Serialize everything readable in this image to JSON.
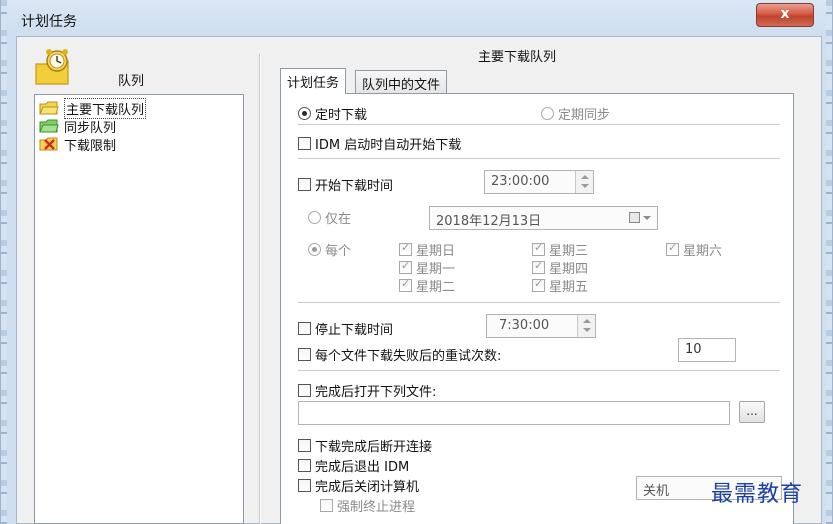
{
  "window": {
    "title": "计划任务",
    "close_label": "x"
  },
  "left": {
    "queue_header": "队列",
    "queues": [
      {
        "label": "主要下载队列",
        "selected": true
      },
      {
        "label": "同步队列",
        "selected": false
      },
      {
        "label": "下载限制",
        "selected": false
      }
    ]
  },
  "right": {
    "pane_title": "主要下载队列",
    "tabs": [
      {
        "label": "计划任务",
        "active": true
      },
      {
        "label": "队列中的文件",
        "active": false
      }
    ],
    "mode": {
      "timed_download": "定时下载",
      "periodic_sync": "定期同步"
    },
    "auto_start_idm": "IDM 启动时自动开始下载",
    "start_time": {
      "label": "开始下载时间",
      "value": "23:00:00"
    },
    "only_on": {
      "label": "仅在",
      "date": "2018年12月13日"
    },
    "every": {
      "label": "每个",
      "days": [
        "星期日",
        "星期一",
        "星期二",
        "星期三",
        "星期四",
        "星期五",
        "星期六"
      ]
    },
    "stop_time": {
      "label": "停止下载时间",
      "value": "7:30:00"
    },
    "retry": {
      "label": "每个文件下载失败后的重试次数:",
      "value": "10"
    },
    "open_file": {
      "label": "完成后打开下列文件:",
      "path": "",
      "browse_label": "..."
    },
    "hang_up": "下载完成后断开连接",
    "exit_idm": "完成后退出 IDM",
    "shutdown": {
      "label": "完成后关闭计算机",
      "option": "关机"
    },
    "force_kill": "强制终止进程"
  },
  "watermark": "最需教育"
}
